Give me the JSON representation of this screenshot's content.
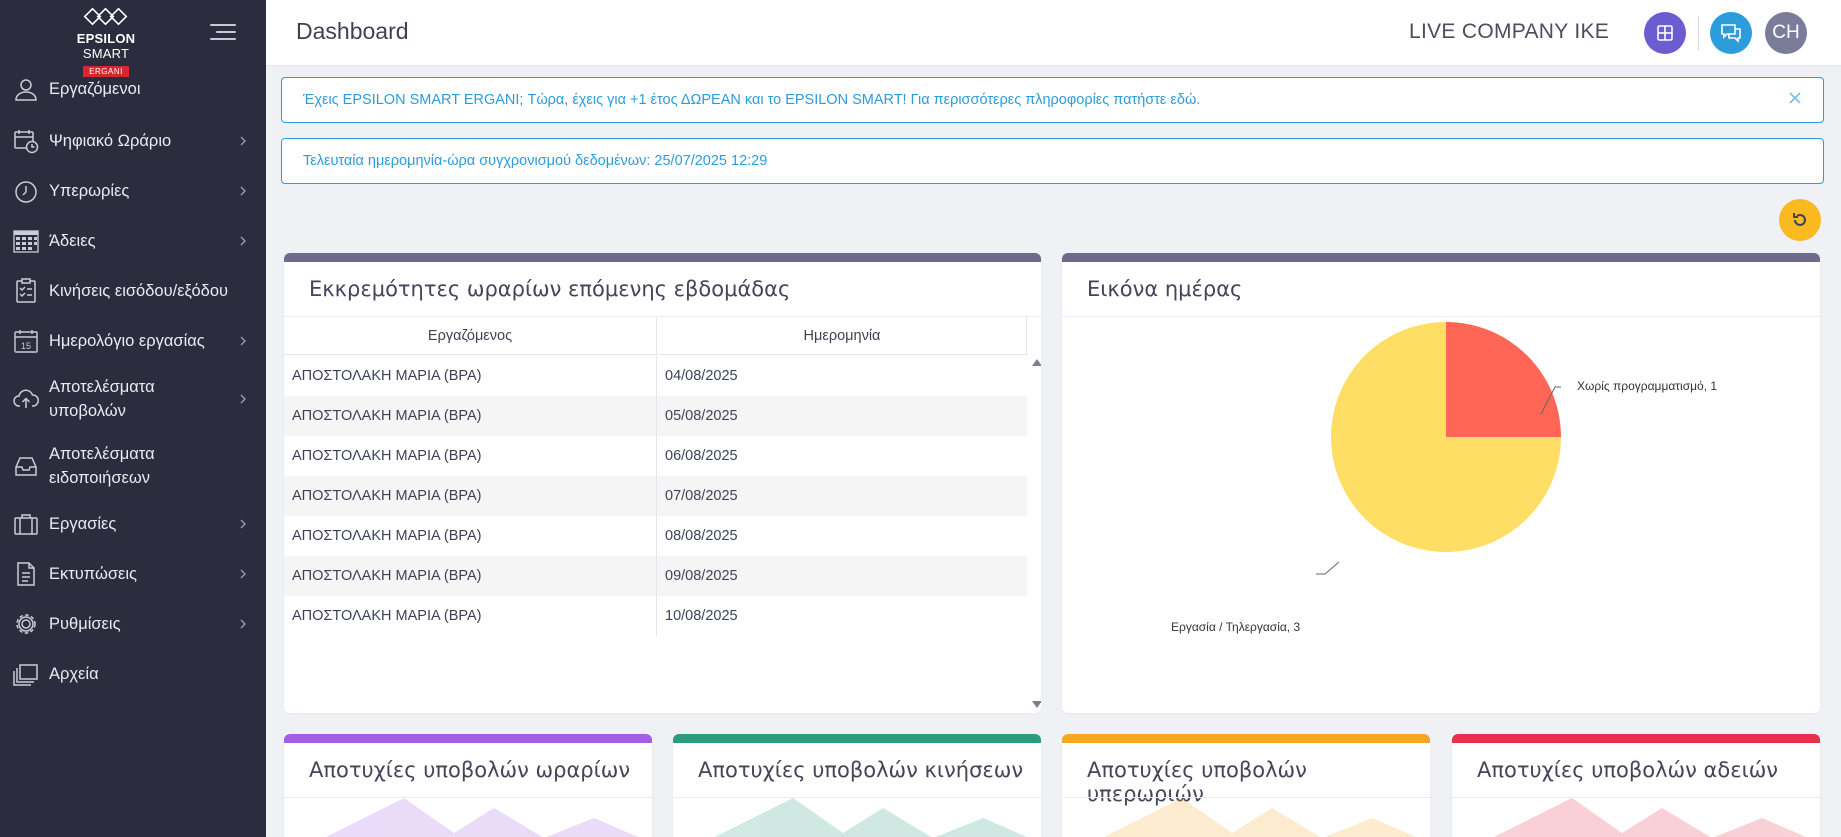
{
  "brand": {
    "name_bold": "EPSILON",
    "name_rest": " SMART",
    "sub": "ERGANI"
  },
  "sidebar": {
    "items": [
      {
        "label": "Εργαζόμενοι",
        "icon": "user-icon",
        "has_submenu": false
      },
      {
        "label": "Ψηφιακό Ωράριο",
        "icon": "calendar-clock-icon",
        "has_submenu": true
      },
      {
        "label": "Υπερωρίες",
        "icon": "stopwatch-icon",
        "has_submenu": true
      },
      {
        "label": "Άδειες",
        "icon": "calendar-grid-icon",
        "has_submenu": true
      },
      {
        "label": "Κινήσεις εισόδου/εξόδου",
        "icon": "clipboard-check-icon",
        "has_submenu": false
      },
      {
        "label": "Ημερολόγιο εργασίας",
        "icon": "calendar-15-icon",
        "has_submenu": true
      },
      {
        "label_line1": "Αποτελέσματα",
        "label_line2": "υποβολών",
        "icon": "cloud-upload-icon",
        "has_submenu": true
      },
      {
        "label_line1": "Αποτελέσματα",
        "label_line2": "ειδοποιήσεων",
        "icon": "inbox-icon",
        "has_submenu": false
      },
      {
        "label": "Εργασίες",
        "icon": "briefcase-icon",
        "has_submenu": true
      },
      {
        "label": "Εκτυπώσεις",
        "icon": "document-icon",
        "has_submenu": true
      },
      {
        "label": "Ρυθμίσεις",
        "icon": "gear-icon",
        "has_submenu": true
      },
      {
        "label": "Αρχεία",
        "icon": "files-icon",
        "has_submenu": false
      }
    ]
  },
  "header": {
    "title": "Dashboard",
    "company": "LIVE COMPANY IKE",
    "avatar_initials": "CH"
  },
  "alerts": {
    "promo": "Έχεις EPSILON SMART ERGANI; Τώρα, έχεις για +1 έτος ΔΩΡΕΑΝ και το EPSILON SMART! Για περισσότερες πληροφορίες πατήστε εδώ.",
    "sync": "Τελευταία ημερομηνία-ώρα συγχρονισμού δεδομένων: 25/07/2025 12:29"
  },
  "pending_card": {
    "title": "Εκκρεμότητες ωραρίων επόμενης εβδομάδας",
    "columns": [
      "Εργαζόμενος",
      "Ημερομηνία"
    ],
    "rows": [
      [
        "ΑΠΟΣΤΟΛΑΚΗ ΜΑΡΙΑ (ΒΡΑ)",
        "04/08/2025"
      ],
      [
        "ΑΠΟΣΤΟΛΑΚΗ ΜΑΡΙΑ (ΒΡΑ)",
        "05/08/2025"
      ],
      [
        "ΑΠΟΣΤΟΛΑΚΗ ΜΑΡΙΑ (ΒΡΑ)",
        "06/08/2025"
      ],
      [
        "ΑΠΟΣΤΟΛΑΚΗ ΜΑΡΙΑ (ΒΡΑ)",
        "07/08/2025"
      ],
      [
        "ΑΠΟΣΤΟΛΑΚΗ ΜΑΡΙΑ (ΒΡΑ)",
        "08/08/2025"
      ],
      [
        "ΑΠΟΣΤΟΛΑΚΗ ΜΑΡΙΑ (ΒΡΑ)",
        "09/08/2025"
      ],
      [
        "ΑΠΟΣΤΟΛΑΚΗ ΜΑΡΙΑ (ΒΡΑ)",
        "10/08/2025"
      ]
    ]
  },
  "day_card": {
    "title": "Εικόνα ημέρας",
    "label_unscheduled": "Χωρίς προγραμματισμό, 1",
    "label_work": "Εργασία / Τηλεργασία, 3"
  },
  "failure_cards": [
    {
      "title": "Αποτυχίες υποβολών ωραρίων",
      "accent": "#a35ee8"
    },
    {
      "title": "Αποτυχίες υποβολών κινήσεων",
      "accent": "#2a9d7f"
    },
    {
      "title": "Αποτυχίες υποβολών υπερωριών",
      "accent": "#f5a623"
    },
    {
      "title": "Αποτυχίες υποβολών αδειών",
      "accent": "#e8304a"
    }
  ],
  "colors": {
    "sidebar_bg": "#2b2d3e",
    "card_bar": "#6e6a8a",
    "info": "#2d9cdb",
    "refresh": "#f8b921"
  },
  "chart_data": {
    "type": "pie",
    "title": "Εικόνα ημέρας",
    "series": [
      {
        "name": "Χωρίς προγραμματισμό",
        "value": 1,
        "color": "#ff6655"
      },
      {
        "name": "Εργασία / Τηλεργασία",
        "value": 3,
        "color": "#ffde66"
      }
    ]
  }
}
